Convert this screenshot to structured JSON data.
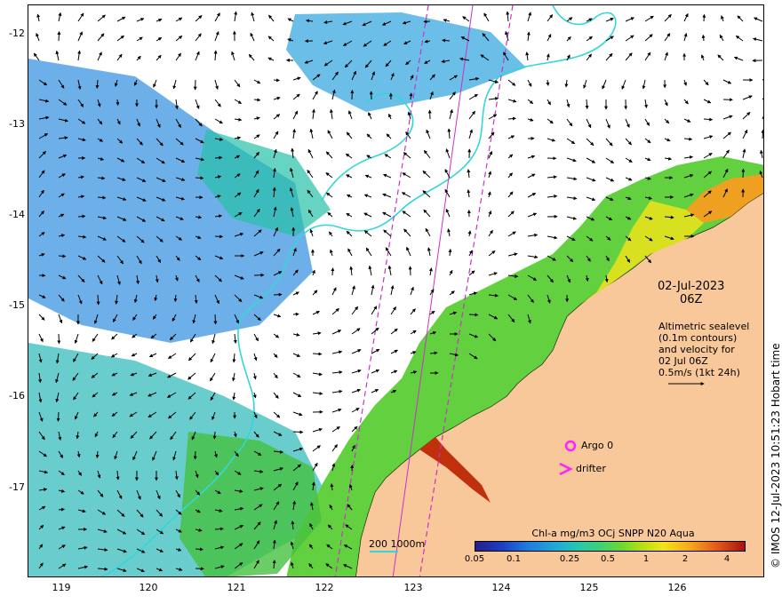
{
  "map": {
    "date_line1": "02-Jul-2023",
    "date_line2": "06Z",
    "annotation": [
      "Altimetric sealevel",
      "(0.1m contours)",
      "and velocity for",
      "02 Jul 06Z",
      "0.5m/s (1kt 24h)"
    ],
    "copyright": "© IMOS 12-Jul-2023 10:51:23 Hobart time",
    "colorbar": {
      "title": "Chl-a mg/m3 OCj SNPP N20 Aqua",
      "ticks": [
        "0.05",
        "0.1",
        "0.25",
        "0.5",
        "1",
        "2",
        "4"
      ]
    },
    "depth_legend": "200  1000m",
    "argo_label": "Argo 0",
    "drifter_label": "drifter",
    "lat_ticks": [
      "-12",
      "-13",
      "-14",
      "-15",
      "-16",
      "-17"
    ],
    "lon_ticks": [
      "119",
      "120",
      "121",
      "122",
      "123",
      "124",
      "125",
      "126"
    ],
    "colors": {
      "land": "#f8c89a",
      "contour": "#35d6d6",
      "track": "#c832c8",
      "marker": "#ff22ff"
    },
    "icons": {
      "argo": "circle-marker-icon",
      "drifter": "chevron-marker-icon",
      "scale_arrow": "arrow-right-icon"
    }
  }
}
